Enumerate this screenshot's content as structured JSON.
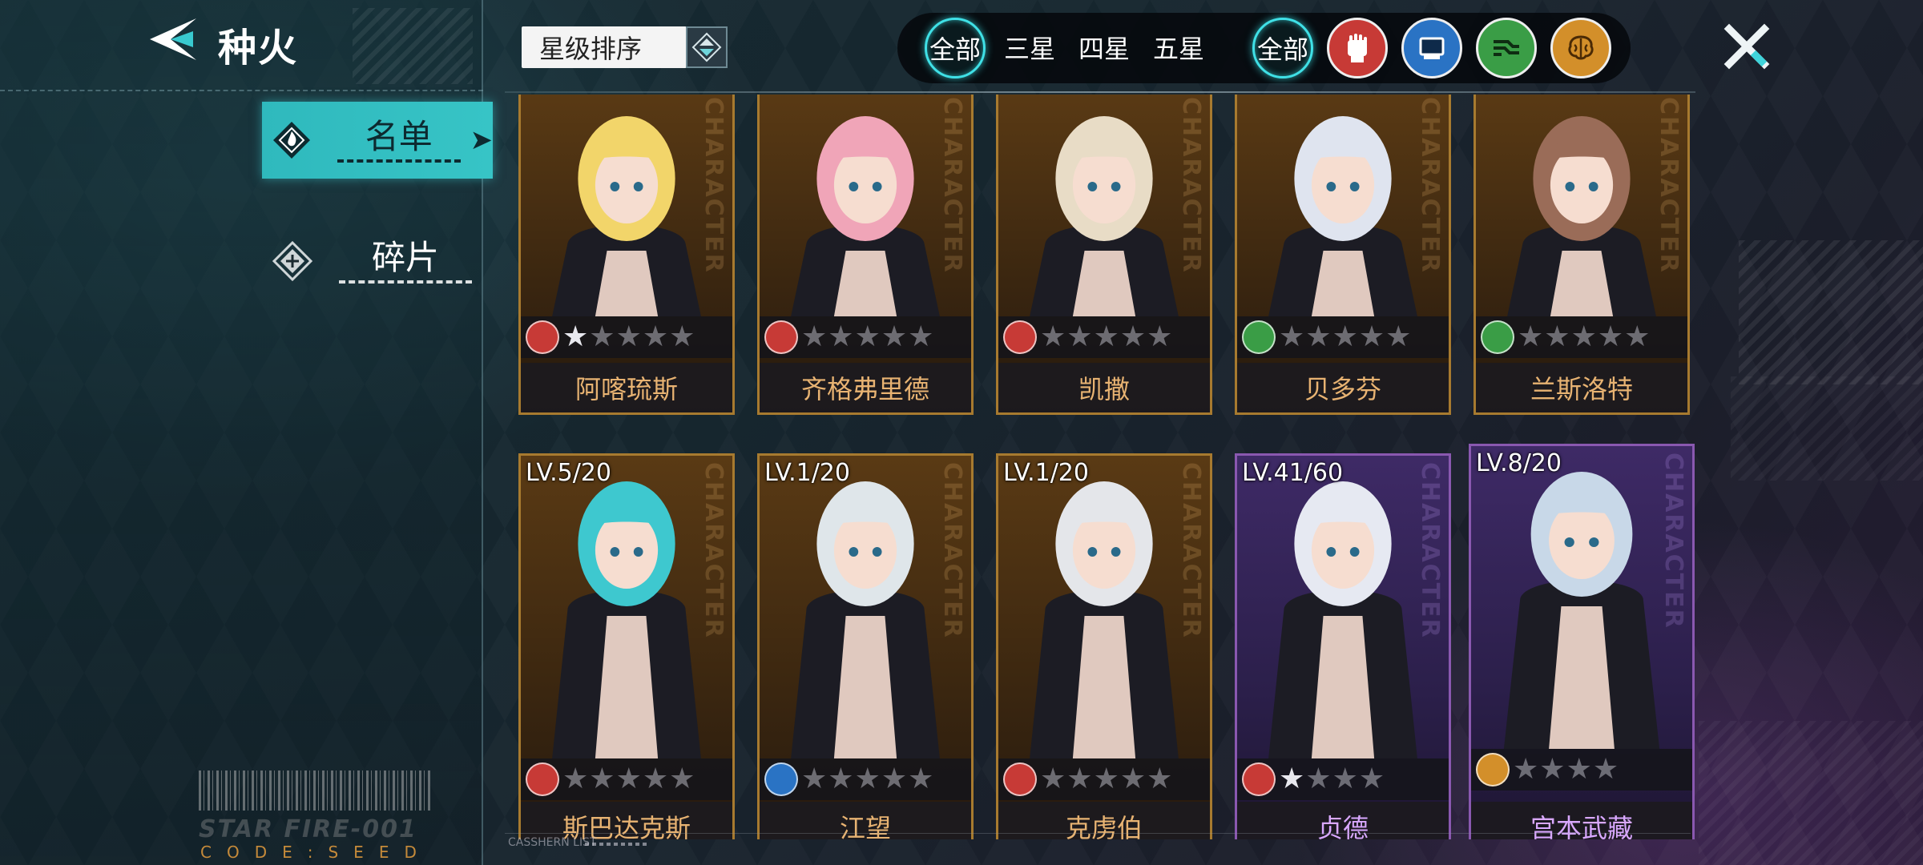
{
  "header": {
    "title": "种火",
    "back_icon": "back-arrow-icon",
    "close_icon": "close-x-icon"
  },
  "sidebar": {
    "items": [
      {
        "label": "名单",
        "icon": "flame-emblem-icon",
        "active": true
      },
      {
        "label": "碎片",
        "icon": "fragment-emblem-icon",
        "active": false
      }
    ],
    "brand": "STAR FIRE-001",
    "code": "CODE:SEED"
  },
  "sort": {
    "label": "星级排序",
    "toggle_icon": "sort-toggle-icon"
  },
  "filters": {
    "rarity": [
      {
        "label": "全部",
        "selected": true
      },
      {
        "label": "三星",
        "selected": false
      },
      {
        "label": "四星",
        "selected": false
      },
      {
        "label": "五星",
        "selected": false
      }
    ],
    "class_all": {
      "label": "全部",
      "selected": true
    },
    "classes": [
      {
        "icon": "fist-icon",
        "color": "#d8423e"
      },
      {
        "icon": "chip-icon",
        "color": "#2e7fd0"
      },
      {
        "icon": "circuit-icon",
        "color": "#3ea84a"
      },
      {
        "icon": "brain-icon",
        "color": "#d8982e"
      }
    ]
  },
  "characters": [
    {
      "name": "阿喀琉斯",
      "level": "",
      "stars": 5,
      "filled": 1,
      "class": "fist",
      "frame": "gold"
    },
    {
      "name": "齐格弗里德",
      "level": "",
      "stars": 5,
      "filled": 0,
      "class": "fist",
      "frame": "gold"
    },
    {
      "name": "凯撒",
      "level": "",
      "stars": 5,
      "filled": 0,
      "class": "fist",
      "frame": "gold"
    },
    {
      "name": "贝多芬",
      "level": "",
      "stars": 5,
      "filled": 0,
      "class": "circuit",
      "frame": "gold"
    },
    {
      "name": "兰斯洛特",
      "level": "",
      "stars": 5,
      "filled": 0,
      "class": "circuit",
      "frame": "gold"
    },
    {
      "name": "斯巴达克斯",
      "level": "LV.5/20",
      "stars": 5,
      "filled": 0,
      "class": "fist",
      "frame": "gold"
    },
    {
      "name": "江望",
      "level": "LV.1/20",
      "stars": 5,
      "filled": 0,
      "class": "chip",
      "frame": "gold"
    },
    {
      "name": "克虏伯",
      "level": "LV.1/20",
      "stars": 5,
      "filled": 0,
      "class": "fist",
      "frame": "gold"
    },
    {
      "name": "贞德",
      "level": "LV.41/60",
      "stars": 4,
      "filled": 1,
      "class": "fist",
      "frame": "purple"
    },
    {
      "name": "宫本武藏",
      "level": "LV.8/20",
      "stars": 4,
      "filled": 0,
      "class": "brain",
      "frame": "purple"
    }
  ],
  "card_watermark": "CHARACTER",
  "footer": {
    "label": "CASSHERN LIST"
  },
  "colors": {
    "accent": "#37c4c6",
    "gold_frame": "#a77a2f",
    "purple_frame": "#8a58b0",
    "name_gold": "#e8b372"
  }
}
